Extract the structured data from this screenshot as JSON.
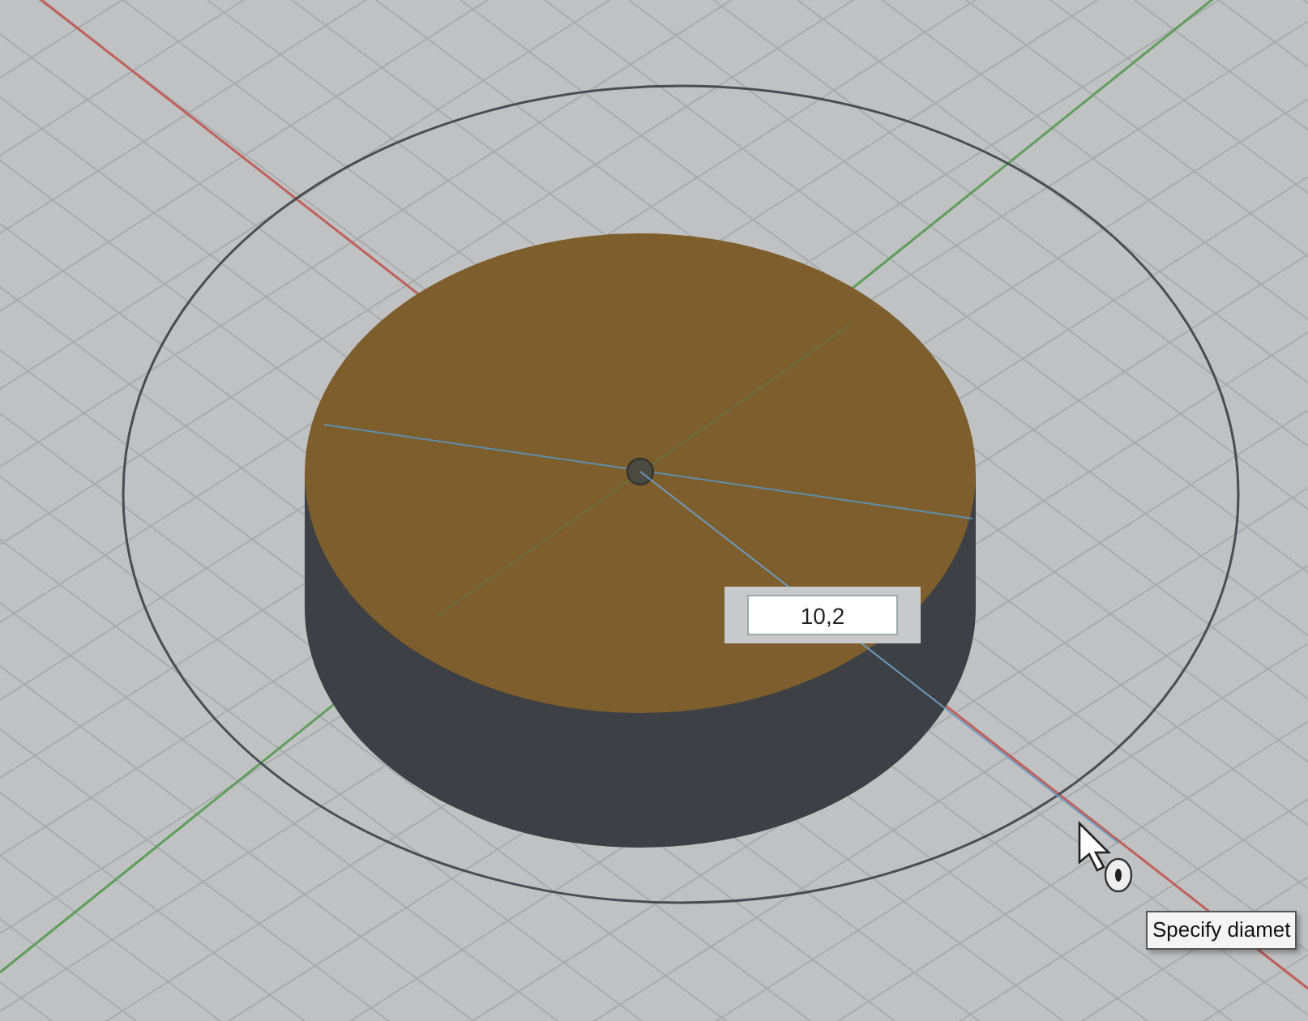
{
  "dimension_input": {
    "value": "10,2"
  },
  "tooltip": {
    "text": "Specify diamet"
  }
}
